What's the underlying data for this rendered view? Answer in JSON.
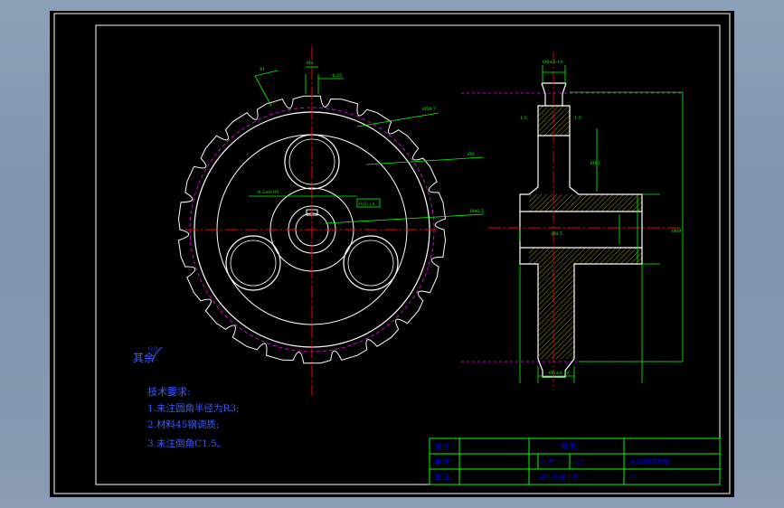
{
  "colors": {
    "background": "#000000",
    "outline": "#ffffff",
    "dimension": "#00ff00",
    "centerline": "#ff0000",
    "pitch_circle": "#ff00ff",
    "notes": "#3b5bff",
    "title_text": "#0000ff",
    "hatch": "#ffff00"
  },
  "front_view": {
    "dims": {
      "top_width": "Ø3",
      "tooth_offset": "4.25",
      "chord": "41",
      "outer_dia": "Ø54.7",
      "shaft_dia": "Ø8",
      "root_dia": "Ø40.5",
      "keyway_dim": "8.2±0.05",
      "keyway_tol_box": "0.02 | A"
    }
  },
  "side_view": {
    "dims": {
      "top_width": "Ø4±0.10",
      "tol1": "1.5",
      "tol2": "1.5",
      "hub_dia": "Ø13",
      "bore": "Ø8.5",
      "overall_height": "Ø69",
      "bottom_width": "Ø5±0.10"
    }
  },
  "roughness": "其余",
  "roughness_value": "12.5",
  "tech_requirements": {
    "title": "技术要求:",
    "items": [
      "1.未注圆角半径为R3;",
      "2.材料45钢调质;",
      "3.未注倒角C1.5。"
    ]
  },
  "title_block": {
    "labels": {
      "design": "设 计",
      "check": "审 核",
      "approve": "批 准",
      "ratio_label": "比 例",
      "ratio_value": "1:1",
      "sheet": "共 1 张  第 1 张"
    },
    "part_name": "链 轮",
    "drawing_name": "从动链轮零件图",
    "material": "45"
  }
}
